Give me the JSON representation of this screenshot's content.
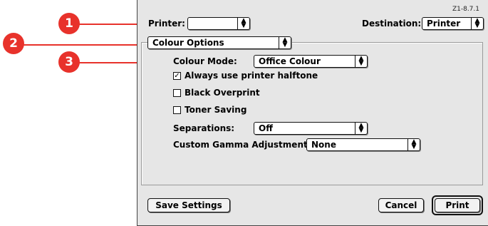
{
  "dialog": {
    "version": "Z1-8.7.1",
    "printer_label": "Printer:",
    "printer_value": "",
    "destination_label": "Destination:",
    "destination_value": "Printer",
    "section_value": "Colour Options"
  },
  "colour": {
    "mode_label": "Colour Mode:",
    "mode_value": "Office Colour",
    "halftone_label": "Always use printer halftone",
    "halftone_checked": true,
    "overprint_label": "Black Overprint",
    "overprint_checked": false,
    "toner_label": "Toner Saving",
    "toner_checked": false,
    "separations_label": "Separations:",
    "separations_value": "Off",
    "gamma_label": "Custom Gamma Adjustment:",
    "gamma_value": "None"
  },
  "footer": {
    "save_label": "Save Settings",
    "cancel_label": "Cancel",
    "print_label": "Print"
  },
  "callouts": [
    "1",
    "2",
    "3"
  ],
  "colors": {
    "callout": "#e8322b"
  },
  "icons": {
    "popup_arrows": "up-down-arrows-icon",
    "check": "checkmark-icon"
  }
}
